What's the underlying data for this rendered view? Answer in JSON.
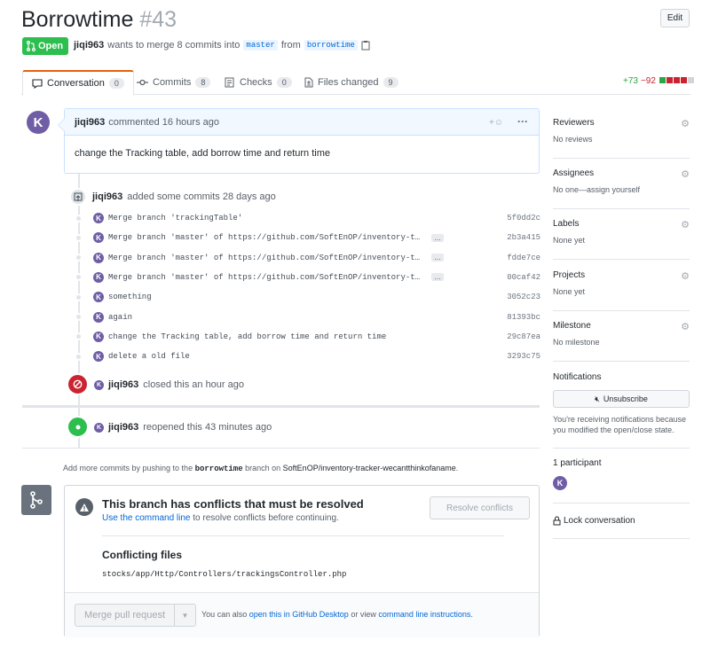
{
  "header": {
    "title": "Borrowtime",
    "number": "#43",
    "edit_label": "Edit",
    "state": "Open",
    "author": "jiqi963",
    "meta_middle": "wants to merge 8 commits into",
    "base_branch": "master",
    "from_word": "from",
    "head_branch": "borrowtime"
  },
  "tabs": [
    {
      "label": "Conversation",
      "count": "0"
    },
    {
      "label": "Commits",
      "count": "8"
    },
    {
      "label": "Checks",
      "count": "0"
    },
    {
      "label": "Files changed",
      "count": "9"
    }
  ],
  "diffstat": {
    "additions": "+73",
    "deletions": "−92",
    "colors": [
      "#28a745",
      "#cb2431",
      "#cb2431",
      "#cb2431",
      "#d1d5da"
    ]
  },
  "comment": {
    "author": "jiqi963",
    "action": "commented 16 hours ago",
    "body": "change the Tracking table, add borrow time and return time",
    "avatar_letter": "K"
  },
  "commits_event": {
    "author": "jiqi963",
    "text": "added some commits 28 days ago"
  },
  "commits": [
    {
      "message": "Merge branch 'trackingTable'",
      "sha": "5f0dd2c",
      "more": ""
    },
    {
      "message": "Merge branch 'master' of https://github.com/SoftEnOP/inventory-tracker…",
      "sha": "2b3a415",
      "more": "…"
    },
    {
      "message": "Merge branch 'master' of https://github.com/SoftEnOP/inventory-tracke…",
      "sha": "fdde7ce",
      "more": "…"
    },
    {
      "message": "Merge branch 'master' of https://github.com/SoftEnOP/inventory-tracke…",
      "sha": "00caf42",
      "more": "…"
    },
    {
      "message": "something",
      "sha": "3052c23",
      "more": ""
    },
    {
      "message": "again",
      "sha": "81393bc",
      "more": ""
    },
    {
      "message": "change the Tracking table, add borrow time and return time",
      "sha": "29c87ea",
      "more": ""
    },
    {
      "message": "delete a old file",
      "sha": "3293c75",
      "more": ""
    }
  ],
  "closed_event": {
    "author": "jiqi963",
    "text": "closed this an hour ago"
  },
  "reopened_event": {
    "author": "jiqi963",
    "text": "reopened this 43 minutes ago"
  },
  "hint": {
    "prefix": "Add more commits by pushing to the",
    "branch": "borrowtime",
    "middle": "branch on",
    "repo": "SoftEnOP/inventory-tracker-wecantthinkofaname",
    "suffix": "."
  },
  "merge": {
    "conflict_title": "This branch has conflicts that must be resolved",
    "use_link": "Use the command line",
    "conflict_sub": "to resolve conflicts before continuing.",
    "resolve_label": "Resolve conflicts",
    "conflicting_title": "Conflicting files",
    "conflicting_file": "stocks/app/Http/Controllers/trackingsController.php",
    "merge_label": "Merge pull request",
    "footer_prefix": "You can also",
    "desktop_link": "open this in GitHub Desktop",
    "footer_middle": "or view",
    "cli_link": "command line instructions",
    "footer_suffix": "."
  },
  "sidebar": {
    "reviewers": {
      "title": "Reviewers",
      "value": "No reviews"
    },
    "assignees": {
      "title": "Assignees",
      "value": "No one—assign yourself"
    },
    "labels": {
      "title": "Labels",
      "value": "None yet"
    },
    "projects": {
      "title": "Projects",
      "value": "None yet"
    },
    "milestone": {
      "title": "Milestone",
      "value": "No milestone"
    },
    "notifications": {
      "title": "Notifications",
      "button": "Unsubscribe",
      "text": "You're receiving notifications because you modified the open/close state."
    },
    "participants": {
      "title": "1 participant",
      "avatar_letter": "K"
    },
    "lock": "Lock conversation"
  },
  "colors": {
    "accent": "#0366d6",
    "open_green": "#2cbe4e",
    "closed_red": "#cb2431",
    "avatar": "#6f5ea6"
  }
}
